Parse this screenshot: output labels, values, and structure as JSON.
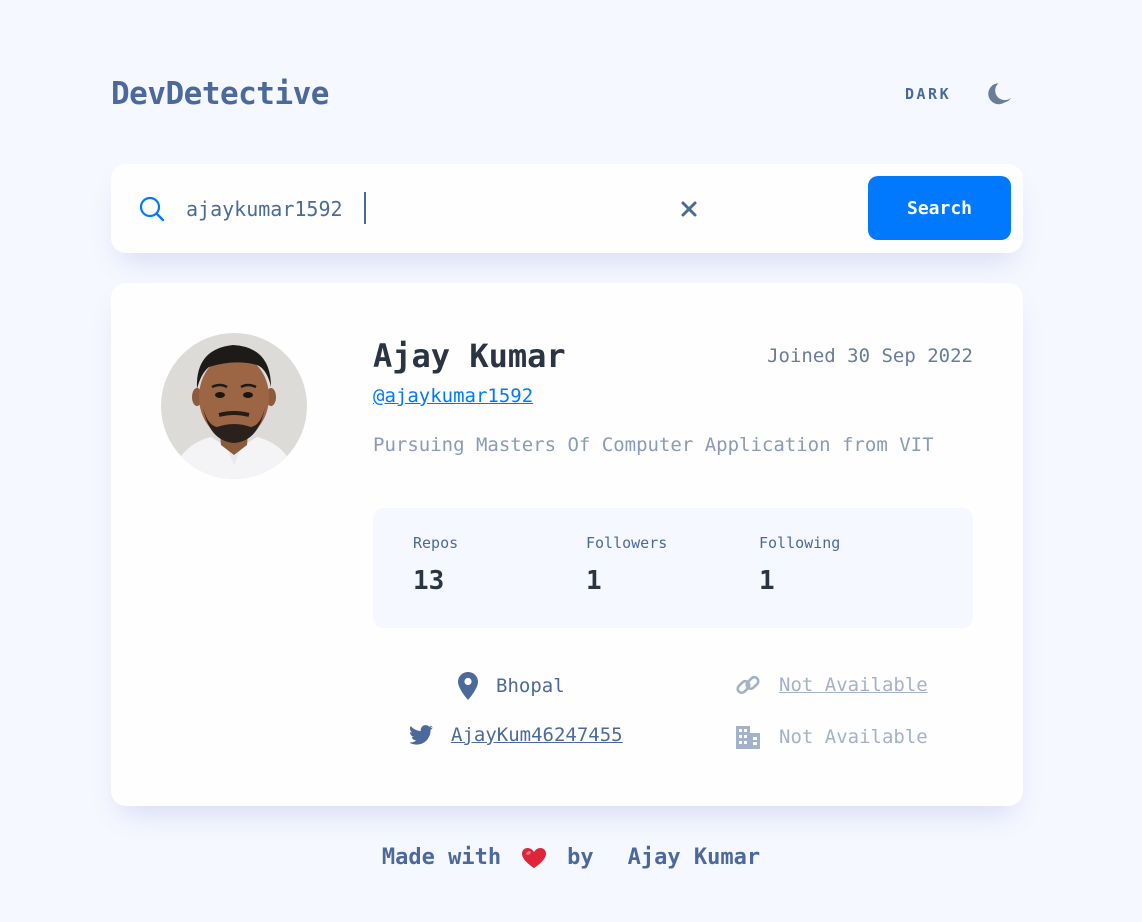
{
  "header": {
    "logo": "DevDetective",
    "theme_label": "DARK",
    "theme_icon": "moon-icon"
  },
  "search": {
    "value": "ajaykumar1592",
    "placeholder": "",
    "icon": "search-icon",
    "clear_icon": "close-icon",
    "button_label": "Search"
  },
  "profile": {
    "name": "Ajay Kumar",
    "joined": "Joined 30 Sep 2022",
    "login": "@ajaykumar1592",
    "bio": "Pursuing Masters Of Computer Application from VIT",
    "stats": [
      {
        "label": "Repos",
        "value": "13"
      },
      {
        "label": "Followers",
        "value": "1"
      },
      {
        "label": "Following",
        "value": "1"
      }
    ],
    "location": "Bhopal",
    "website": "Not Available",
    "twitter": "AjayKum46247455",
    "company": "Not Available"
  },
  "footer": {
    "made_with": "Made with",
    "by": "by",
    "author": "Ajay Kumar",
    "heart_icon": "heart-icon"
  },
  "colors": {
    "background": "#f6f8ff",
    "card": "#fefefe",
    "accent": "#0079ff",
    "text_primary": "#2b3442",
    "text_secondary": "#4b6a9b",
    "muted": "#a4b2c9"
  }
}
